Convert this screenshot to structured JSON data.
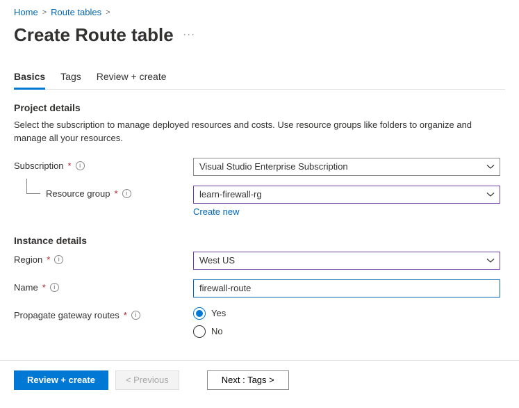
{
  "breadcrumb": {
    "home": "Home",
    "routeTables": "Route tables"
  },
  "title": "Create Route table",
  "tabs": {
    "basics": "Basics",
    "tags": "Tags",
    "reviewCreate": "Review + create"
  },
  "sections": {
    "projectDetails": {
      "title": "Project details",
      "description": "Select the subscription to manage deployed resources and costs. Use resource groups like folders to organize and manage all your resources."
    },
    "instanceDetails": {
      "title": "Instance details"
    }
  },
  "fields": {
    "subscription": {
      "label": "Subscription",
      "value": "Visual Studio Enterprise Subscription"
    },
    "resourceGroup": {
      "label": "Resource group",
      "value": "learn-firewall-rg",
      "createNew": "Create new"
    },
    "region": {
      "label": "Region",
      "value": "West US"
    },
    "name": {
      "label": "Name",
      "value": "firewall-route"
    },
    "propagate": {
      "label": "Propagate gateway routes",
      "yes": "Yes",
      "no": "No"
    }
  },
  "footer": {
    "reviewCreate": "Review + create",
    "previous": "< Previous",
    "next": "Next : Tags >"
  }
}
